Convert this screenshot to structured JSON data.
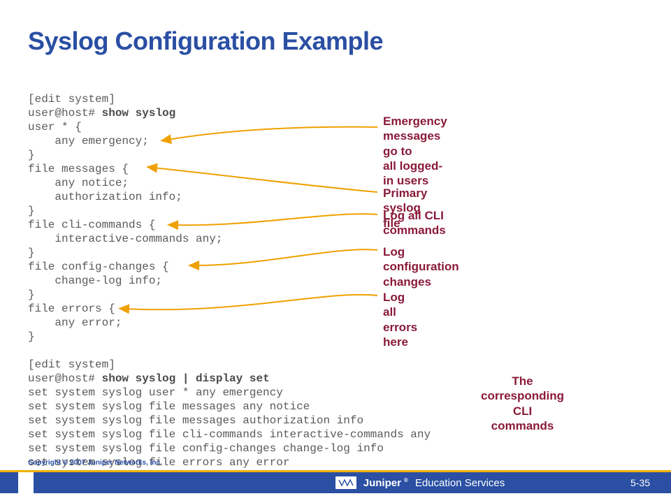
{
  "title": "Syslog Configuration Example",
  "code": {
    "l1": "[edit system]",
    "l2a": "user@host# ",
    "l2b": "show syslog",
    "l3": "user * {",
    "l4": "    any emergency;",
    "l5": "}",
    "l6": "file messages {",
    "l7": "    any notice;",
    "l8": "    authorization info;",
    "l9": "}",
    "l10": "file cli-commands {",
    "l11": "    interactive-commands any;",
    "l12": "}",
    "l13": "file config-changes {",
    "l14": "    change-log info;",
    "l15": "}",
    "l16": "file errors {",
    "l17": "    any error;",
    "l18": "}",
    "l19": "",
    "l20": "[edit system]",
    "l21a": "user@host# ",
    "l21b": "show syslog | display set",
    "l22": "set system syslog user * any emergency",
    "l23": "set system syslog file messages any notice",
    "l24": "set system syslog file messages authorization info",
    "l25": "set system syslog file cli-commands interactive-commands any",
    "l26": "set system syslog file config-changes change-log info",
    "l27": "set system syslog file errors any error"
  },
  "callouts": {
    "c1a": "Emergency messages go to",
    "c1b": "all logged-in users",
    "c2": "Primary syslog file",
    "c3": "Log all CLI commands",
    "c4": "Log configuration changes",
    "c5": "Log all errors here",
    "c6a": "The corresponding CLI",
    "c6b": "commands"
  },
  "footer": {
    "copyright": "Copyright © 2007 Juniper Networks, Inc.",
    "brand": "Juniper",
    "edu": "Education Services",
    "page": "5-35"
  }
}
